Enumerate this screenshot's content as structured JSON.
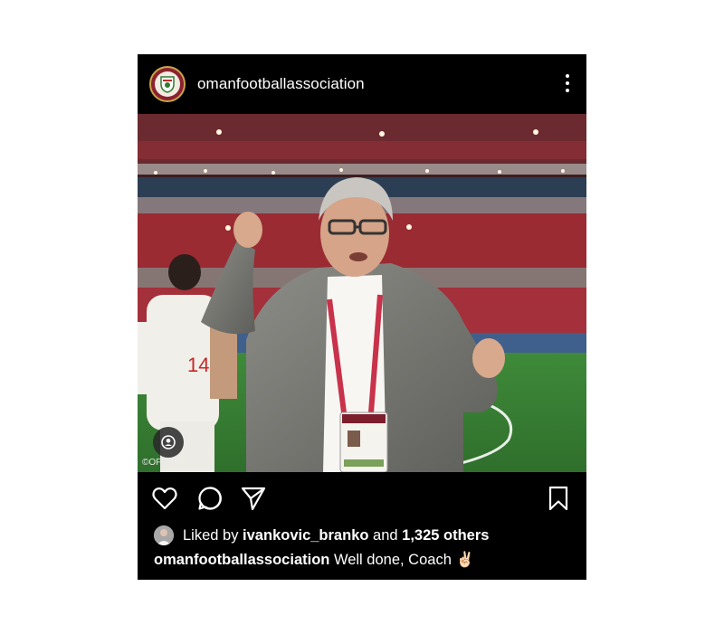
{
  "post": {
    "username": "omanfootballassociation",
    "photo_credit": "©OFA",
    "liked_prefix": "Liked by ",
    "liked_user": "ivankovic_branko",
    "liked_and": " and ",
    "liked_others": "1,325 others",
    "caption_user": "omanfootballassociation",
    "caption_text": " Well done, Coach ",
    "caption_emoji": "✌🏻"
  },
  "icons": {
    "avatar": "oman-fa-logo",
    "more": "more-vertical-icon",
    "tag": "person-tag-icon",
    "like": "heart-icon",
    "comment": "comment-icon",
    "share": "send-icon",
    "save": "bookmark-icon"
  }
}
